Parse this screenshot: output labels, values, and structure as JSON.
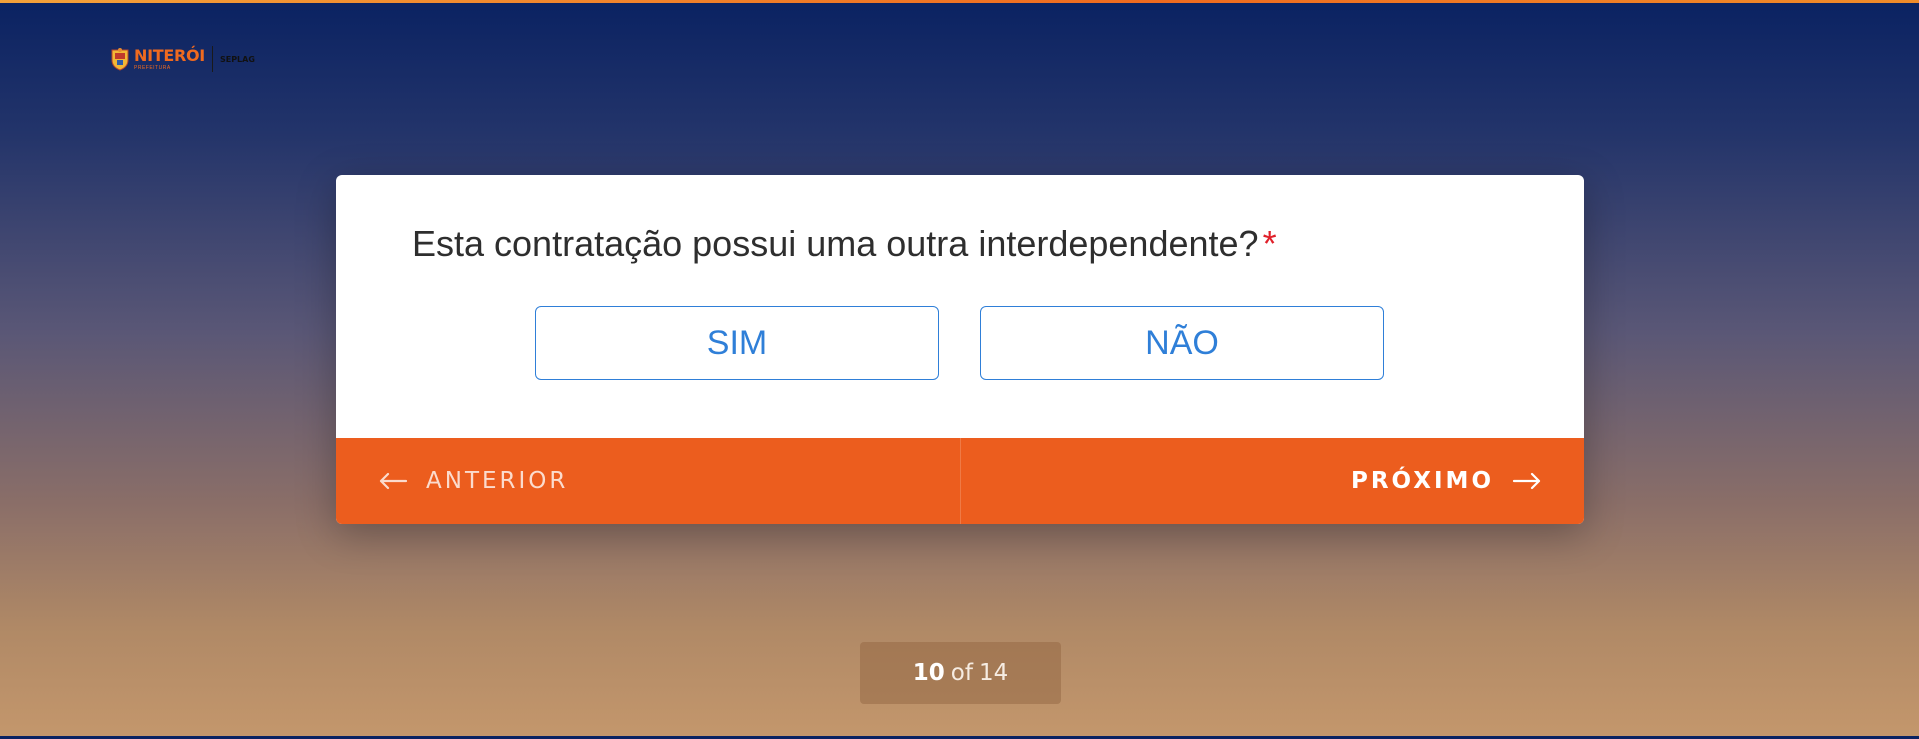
{
  "logo": {
    "name": "NITERÓI",
    "subtitle": "PREFEITURA",
    "department": "SEPLAG"
  },
  "form": {
    "question": "Esta contratação possui uma outra interdependente?",
    "required_mark": "*",
    "options": [
      {
        "label": "SIM"
      },
      {
        "label": "NÃO"
      }
    ]
  },
  "navigation": {
    "prev_label": "ANTERIOR",
    "next_label": "PRÓXIMO",
    "prev_icon": "arrow-left-icon",
    "next_icon": "arrow-right-icon"
  },
  "pager": {
    "current": "10",
    "of_label": "of",
    "total": "14"
  },
  "colors": {
    "accent_orange": "#ec5d1e",
    "option_blue": "#2f7fd8",
    "required_red": "#e0202a",
    "background_top": "#0a2262",
    "background_bottom": "#c4976c"
  }
}
